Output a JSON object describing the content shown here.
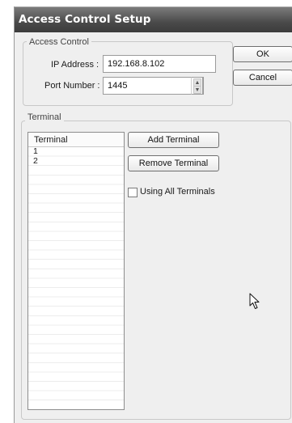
{
  "window": {
    "title": "Access Control Setup"
  },
  "access_control": {
    "legend": "Access Control",
    "ip_label": "IP Address :",
    "ip_value": "192.168.8.102",
    "port_label": "Port Number :",
    "port_value": "1445"
  },
  "buttons": {
    "ok": "OK",
    "cancel": "Cancel"
  },
  "terminal": {
    "legend": "Terminal",
    "list_header": "Terminal",
    "rows": [
      "1",
      "2"
    ],
    "add_label": "Add Terminal",
    "remove_label": "Remove Terminal",
    "use_all_label": "Using All Terminals",
    "use_all_checked": false
  },
  "icons": {
    "spin_up": "spin-up-icon",
    "spin_down": "spin-down-icon",
    "cursor": "mouse-pointer-icon"
  }
}
